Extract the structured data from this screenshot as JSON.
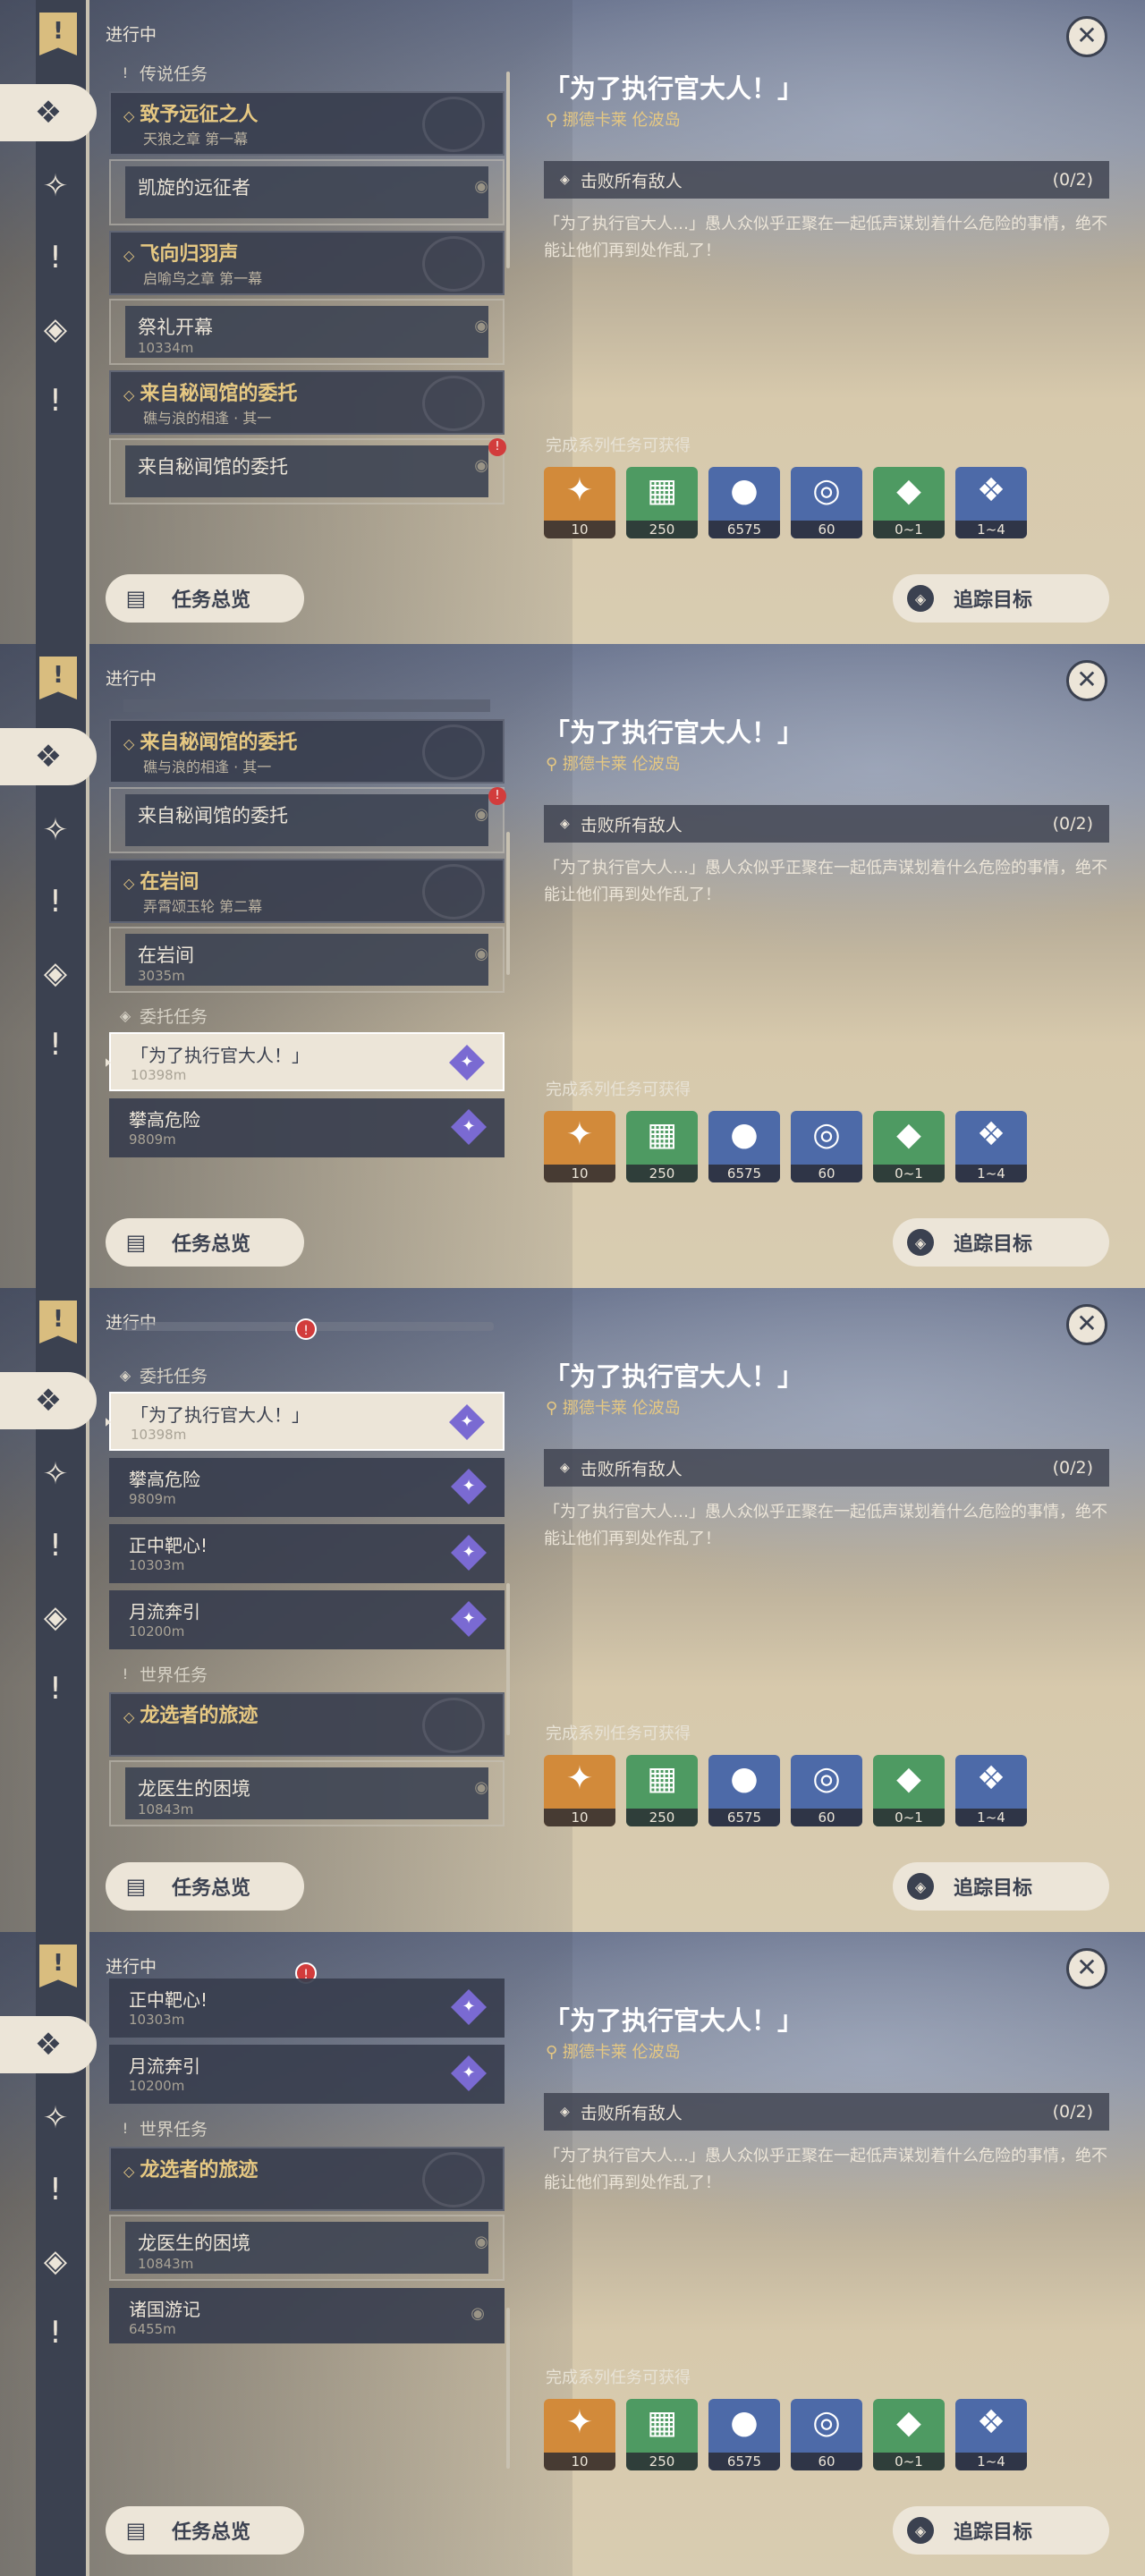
{
  "common": {
    "header": "进行中",
    "overview_label": "任务总览",
    "track_label": "追踪目标",
    "close": "✕",
    "quest_title": "「为了执行官大人！」",
    "location": "挪德卡莱 伦波岛",
    "objective": {
      "text": "击败所有敌人",
      "count": "(0/2)"
    },
    "description": "「为了执行官大人…」愚人众似乎正聚在一起低声谋划着什么危险的事情，绝不能让他们再到处作乱了！",
    "rewards_label": "完成系列任务可获得",
    "rewards": [
      {
        "icon": "primogem-icon",
        "glyph": "✦",
        "qty": "10",
        "color": "#d28a3a"
      },
      {
        "icon": "adventure-exp-icon",
        "glyph": "▦",
        "qty": "250",
        "color": "#4e9a62"
      },
      {
        "icon": "mora-icon",
        "glyph": "●",
        "qty": "6575",
        "color": "#4d6aa8"
      },
      {
        "icon": "companionship-exp-icon",
        "glyph": "◎",
        "qty": "60",
        "color": "#4d6aa8"
      },
      {
        "icon": "crystal-icon",
        "glyph": "◆",
        "qty": "0~1",
        "color": "#4e9a62"
      },
      {
        "icon": "crystal-chunk-icon",
        "glyph": "❖",
        "qty": "1~4",
        "color": "#4d6aa8"
      }
    ]
  },
  "panel1": {
    "section_legend": "传说任务",
    "g1": {
      "title": "致予远征之人",
      "sub": "天狼之章 第一幕"
    },
    "g1_item": {
      "name": "凯旋的远征者"
    },
    "g2": {
      "title": "飞向归羽声",
      "sub": "启喻鸟之章 第一幕"
    },
    "g2_item": {
      "name": "祭礼开幕",
      "dist": "10334m"
    },
    "g3": {
      "title": "来自秘闻馆的委托",
      "sub": "礁与浪的相逢 · 其一"
    },
    "g3_item": {
      "name": "来自秘闻馆的委托"
    }
  },
  "panel2": {
    "g1": {
      "title": "来自秘闻馆的委托",
      "sub": "礁与浪的相逢 · 其一"
    },
    "g1_item": {
      "name": "来自秘闻馆的委托"
    },
    "g2": {
      "title": "在岩间",
      "sub": "弄霄颂玉轮 第二幕"
    },
    "g2_item": {
      "name": "在岩间",
      "dist": "3035m"
    },
    "section_commission": "委托任务",
    "c1": {
      "name": "「为了执行官大人！」",
      "dist": "10398m"
    },
    "c2": {
      "name": "攀高危险",
      "dist": "9809m"
    }
  },
  "panel3": {
    "section_commission": "委托任务",
    "c1": {
      "name": "「为了执行官大人！」",
      "dist": "10398m"
    },
    "c2": {
      "name": "攀高危险",
      "dist": "9809m"
    },
    "c3": {
      "name": "正中靶心!",
      "dist": "10303m"
    },
    "c4": {
      "name": "月流奔引",
      "dist": "10200m"
    },
    "section_world": "世界任务",
    "w1": {
      "title": "龙选者的旅迹"
    },
    "w1_item": {
      "name": "龙医生的困境",
      "dist": "10843m"
    }
  },
  "panel4": {
    "c3": {
      "name": "正中靶心!",
      "dist": "10303m"
    },
    "c4": {
      "name": "月流奔引",
      "dist": "10200m"
    },
    "section_world": "世界任务",
    "w1": {
      "title": "龙选者的旅迹"
    },
    "w1_item": {
      "name": "龙医生的困境",
      "dist": "10843m"
    },
    "w2": {
      "name": "诸国游记",
      "dist": "6455m"
    }
  }
}
